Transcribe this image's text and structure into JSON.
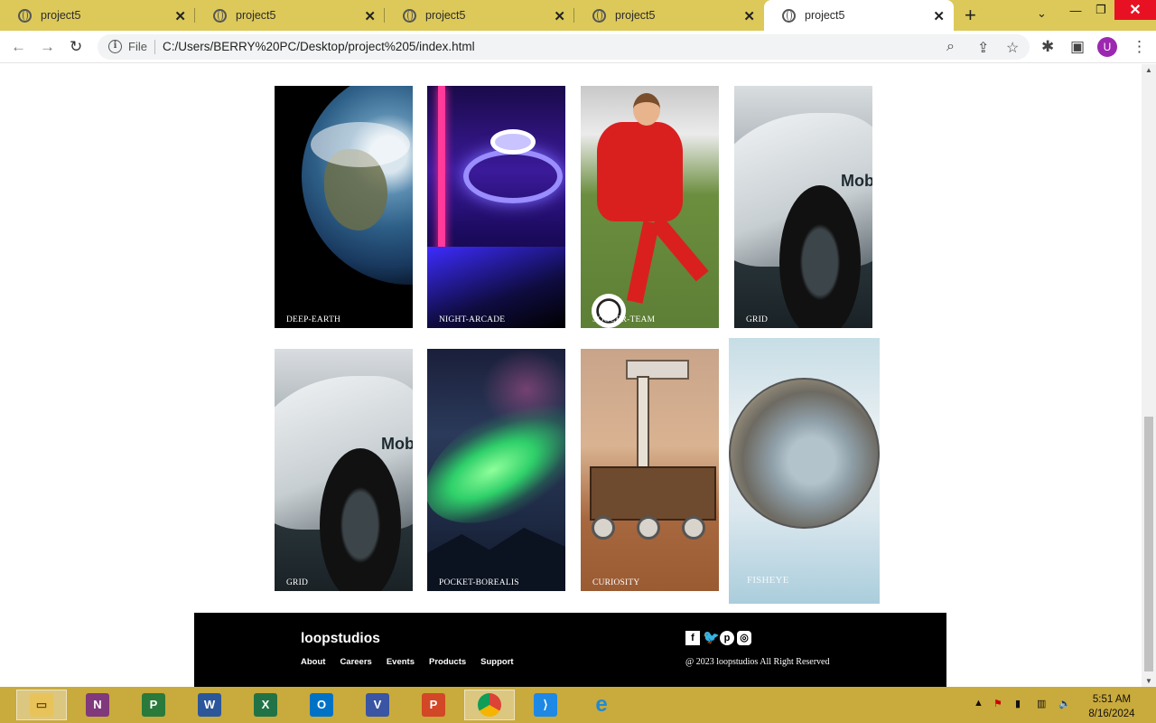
{
  "browser": {
    "tabs": [
      {
        "title": "project5"
      },
      {
        "title": "project5"
      },
      {
        "title": "project5"
      },
      {
        "title": "project5"
      },
      {
        "title": "project5",
        "active": true
      }
    ],
    "address": {
      "scheme_label": "File",
      "url": "C:/Users/BERRY%20PC/Desktop/project%205/index.html"
    },
    "profile_initial": "U"
  },
  "gallery": {
    "cards": [
      {
        "caption": "DEEP-EARTH"
      },
      {
        "caption": "NIGHT-ARCADE"
      },
      {
        "caption": "SOCCER-TEAM"
      },
      {
        "caption": "GRID"
      },
      {
        "caption": "GRID"
      },
      {
        "caption": "POCKET-BOREALIS"
      },
      {
        "caption": "CURIOSITY"
      },
      {
        "caption": "FISHEYE"
      }
    ]
  },
  "footer": {
    "brand": "loopstudios",
    "nav": [
      "About",
      "Careers",
      "Events",
      "Products",
      "Support"
    ],
    "copyright": "@ 2023 loopstudios All Right Reserved",
    "social_icons": [
      "facebook-icon",
      "twitter-icon",
      "pinterest-icon",
      "instagram-icon"
    ]
  },
  "taskbar": {
    "apps": [
      "file-explorer",
      "onenote",
      "project",
      "word",
      "excel",
      "outlook",
      "visio",
      "powerpoint",
      "chrome",
      "vscode",
      "internet-explorer"
    ],
    "time": "5:51 AM",
    "date": "8/16/2024"
  }
}
